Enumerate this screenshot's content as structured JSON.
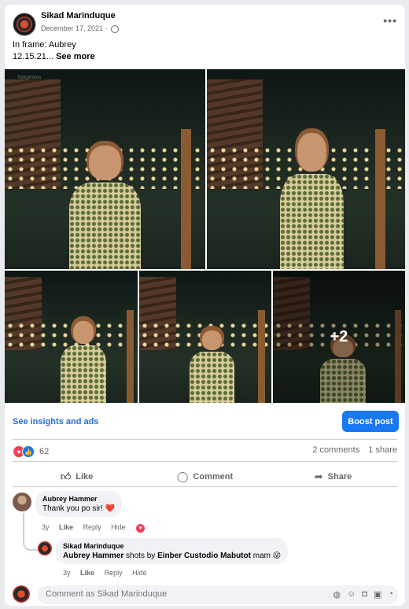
{
  "post": {
    "page_name": "Sikad Marinduque",
    "date": "December 17, 2021 ·",
    "caption_line1": "In frame: Aubrey",
    "caption_line2": "12.15.21...",
    "see_more": "See more",
    "watermark": "©jdcphotos",
    "more_photos": "+2"
  },
  "promo": {
    "insights_label": "See insights and ads",
    "boost_label": "Boost post"
  },
  "engagement": {
    "reaction_count": "62",
    "comments": "2 comments",
    "shares": "1 share"
  },
  "actions": {
    "like": "Like",
    "comment": "Comment",
    "share": "Share"
  },
  "comments": [
    {
      "author": "Aubrey Hammer",
      "text": "Thank you po sir! ❤️",
      "age": "3y",
      "like": "Like",
      "reply": "Reply",
      "hide": "Hide"
    },
    {
      "author": "Sikad Marinduque",
      "mention": "Aubrey Hammer",
      "text_mid": " shots by ",
      "mention2": "Einber Custodio Mabutot",
      "text_end": " mam 😜",
      "age": "3y",
      "like": "Like",
      "reply": "Reply",
      "hide": "Hide"
    }
  ],
  "composer": {
    "placeholder": "Comment as Sikad Marinduque"
  },
  "colors": {
    "accent": "#1877f2",
    "link": "#216fdb",
    "love": "#f33e58"
  }
}
